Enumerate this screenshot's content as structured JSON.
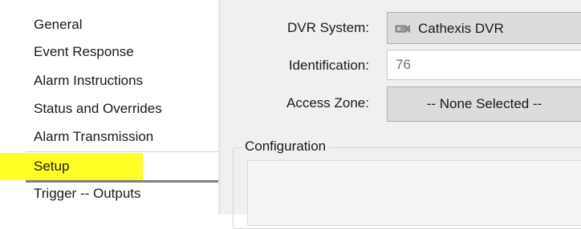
{
  "sidebar": {
    "items": [
      {
        "label": "General"
      },
      {
        "label": "Event Response"
      },
      {
        "label": "Alarm Instructions"
      },
      {
        "label": "Status and Overrides"
      },
      {
        "label": "Alarm Transmission"
      },
      {
        "label": "Setup",
        "selected": true,
        "highlight_color": "#ffff00"
      },
      {
        "label": "Trigger -- Outputs"
      }
    ]
  },
  "setup": {
    "dvr_system": {
      "label": "DVR System:",
      "value": "Cathexis DVR",
      "icon": "camera-icon"
    },
    "identification": {
      "label": "Identification:",
      "value": "76"
    },
    "access_zone": {
      "label": "Access Zone:",
      "value": "-- None Selected --"
    },
    "configuration": {
      "title": "Configuration"
    }
  }
}
